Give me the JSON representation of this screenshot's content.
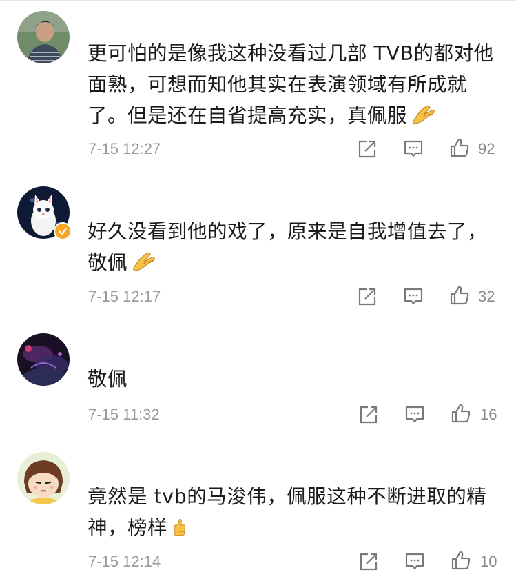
{
  "comments": [
    {
      "text": "更可怕的是像我这种没看过几部 TVB的都对他面熟，可想而知他其实在表演领域有所成就了。但是还在自省提高充实，真佩服",
      "emoji": "clap-hands-emoji",
      "time": "7-15 12:27",
      "likes": "92"
    },
    {
      "text": "好久没看到他的戏了，原来是自我增值去了，敬佩",
      "emoji": "clap-hands-emoji",
      "time": "7-15 12:17",
      "likes": "32"
    },
    {
      "text": "敬佩",
      "time": "7-15 11:32",
      "likes": "16"
    },
    {
      "text": "竟然是 tvb的马浚伟，佩服这种不断进取的精神，榜样",
      "emoji": "thumbs-up-emoji",
      "time": "7-15 12:14",
      "likes": "10"
    }
  ],
  "colors": {
    "text": "#1a1a1a",
    "meta": "#9a9a9a",
    "icon": "#7a7a7a",
    "divider": "#e8e8e8",
    "verified": "#f5a623"
  },
  "icons": {
    "share": "share-icon",
    "comment": "comment-icon",
    "like": "like-icon"
  }
}
